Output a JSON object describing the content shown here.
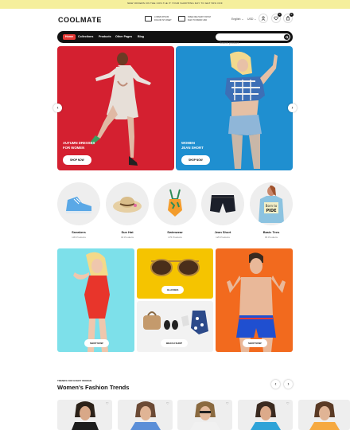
{
  "announcement": "New offers on the Cos.tle it your shopping day to get 50% off",
  "header": {
    "logo": "COOLMATE",
    "features": [
      {
        "icon": "truck-icon",
        "text": "Lorem ipsum\nDolor sit amet"
      },
      {
        "icon": "delivery-icon",
        "text": "Free delivery from\n$120 to $6000 usd"
      }
    ],
    "language": "English ⌄",
    "currency": "USD ⌄",
    "wishlist_count": "0",
    "cart_count": "0"
  },
  "nav": {
    "items": [
      {
        "label": "Home",
        "active": true
      },
      {
        "label": "Collections"
      },
      {
        "label": "Products"
      },
      {
        "label": "Other Pages"
      },
      {
        "label": "Blog"
      }
    ],
    "search_placeholder": "Search product..."
  },
  "hero": [
    {
      "caption": "Autumn Dresses\nFor Women",
      "button": "Shop Now",
      "bg": "#d42030"
    },
    {
      "caption": "Women\nJean Short",
      "button": "Shop Now",
      "bg": "#1f8fd0"
    }
  ],
  "categories": [
    {
      "name": "Sneakers",
      "count": "105 Products",
      "icon": "sneaker-icon"
    },
    {
      "name": "Sun Hat",
      "count": "30 Products",
      "icon": "sun-hat-icon"
    },
    {
      "name": "Swimwear",
      "count": "175 Products",
      "icon": "swimwear-icon"
    },
    {
      "name": "Jean Short",
      "count": "125 Products",
      "icon": "jean-short-icon"
    },
    {
      "name": "Basic Tees",
      "count": "65 Products",
      "icon": "tee-icon"
    }
  ],
  "promos": {
    "swim_button": "Shop Now",
    "glasses_button": "Glasses",
    "beach_button": "Beach Shop",
    "men_button": "Shop Now"
  },
  "section": {
    "subtitle": "Trends for every woman",
    "title": "Women's Fashion Trends"
  },
  "tee_print": "Born to PIDE"
}
